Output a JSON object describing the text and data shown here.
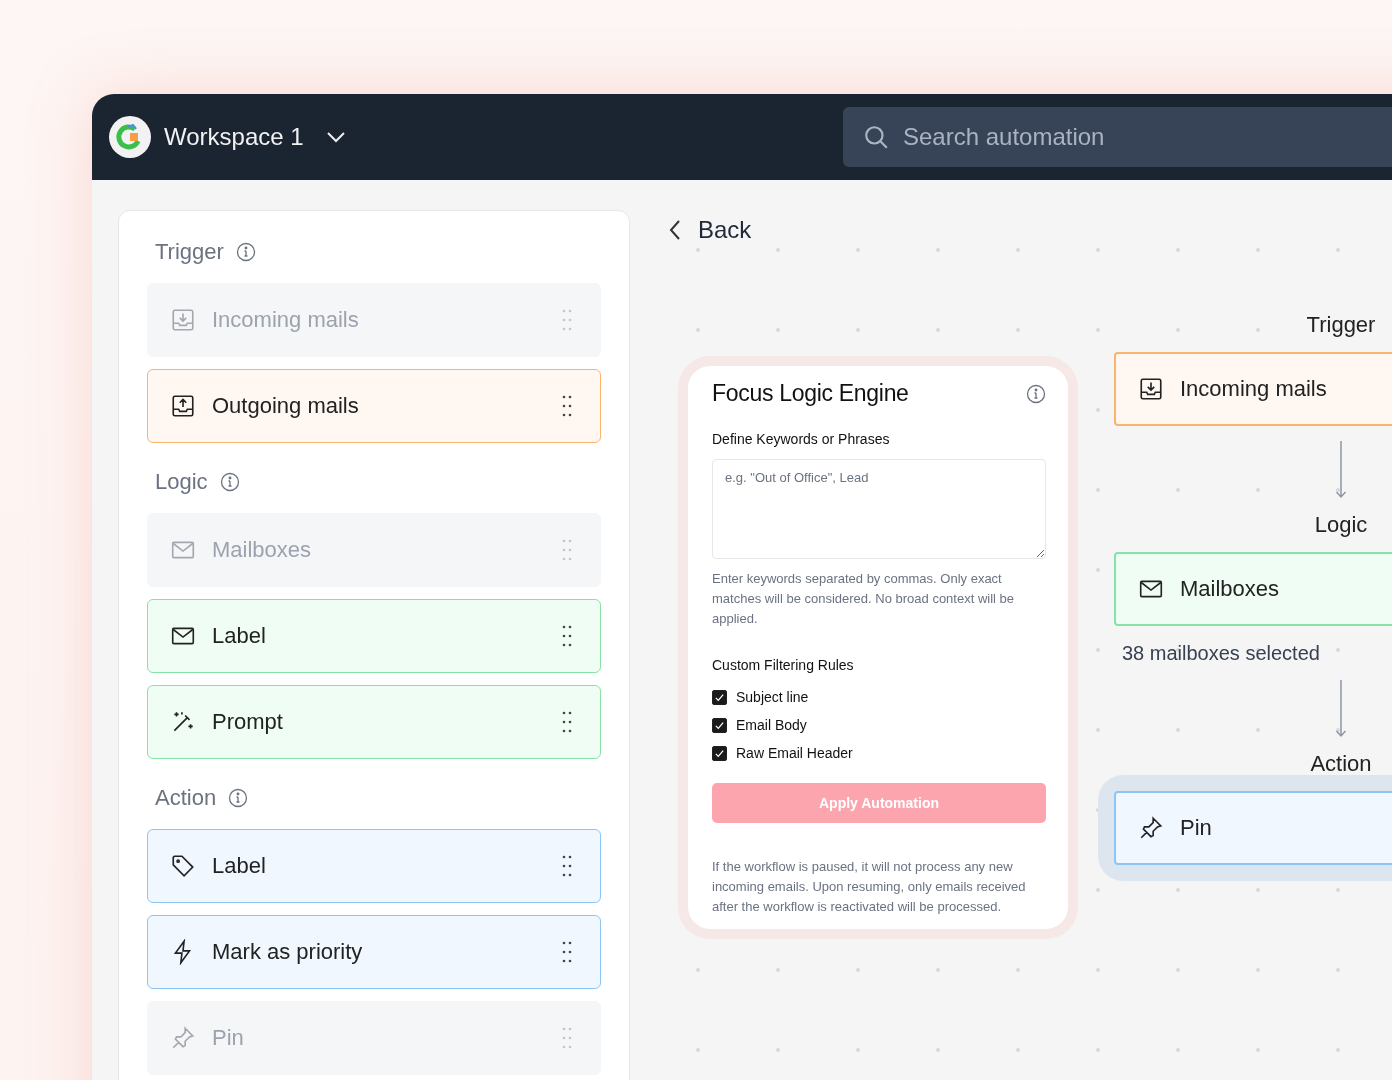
{
  "workspace": {
    "name": "Workspace 1"
  },
  "search": {
    "placeholder": "Search automation"
  },
  "sidebar": {
    "sections": [
      {
        "title": "Trigger",
        "kind": "trigger",
        "items": [
          {
            "label": "Incoming mails",
            "kind": "download",
            "disabled": true
          },
          {
            "label": "Outgoing mails",
            "kind": "upload",
            "disabled": false
          }
        ]
      },
      {
        "title": "Logic",
        "kind": "logic",
        "items": [
          {
            "label": "Mailboxes",
            "kind": "envelope",
            "disabled": true
          },
          {
            "label": "Label",
            "kind": "envelope",
            "disabled": false
          },
          {
            "label": "Prompt",
            "kind": "wand",
            "disabled": false
          }
        ]
      },
      {
        "title": "Action",
        "kind": "action",
        "items": [
          {
            "label": "Label",
            "kind": "tag",
            "disabled": false
          },
          {
            "label": "Mark as priority",
            "kind": "bolt",
            "disabled": false
          },
          {
            "label": "Pin",
            "kind": "pin",
            "disabled": true
          }
        ]
      }
    ]
  },
  "back": {
    "label": "Back"
  },
  "card": {
    "title": "Focus Logic Engine",
    "keywords_label": "Define Keywords or Phrases",
    "keywords_placeholder": "e.g. \"Out of Office\", Lead",
    "keywords_help": "Enter keywords separated by commas. Only exact matches will be considered. No broad context will be applied.",
    "rules_title": "Custom Filtering Rules",
    "rules": [
      {
        "label": "Subject line",
        "checked": true
      },
      {
        "label": "Email Body",
        "checked": true
      },
      {
        "label": "Raw Email Header",
        "checked": true
      }
    ],
    "button": {
      "label": "Apply Automation",
      "disabled": true
    },
    "note": "If the workflow is paused, it will not process any new incoming emails. Upon resuming, only emails received after the workflow is reactivated will be processed."
  },
  "flow": {
    "steps": [
      {
        "title": "Trigger",
        "kind": "trigger",
        "node": {
          "label": "Incoming mails",
          "kind": "download",
          "selected": false
        }
      },
      {
        "title": "Logic",
        "kind": "logic",
        "node": {
          "label": "Mailboxes",
          "kind": "envelope",
          "selected": false
        },
        "note": "38 mailboxes selected"
      },
      {
        "title": "Action",
        "kind": "action",
        "node": {
          "label": "Pin",
          "kind": "pin",
          "selected": true
        }
      }
    ]
  }
}
